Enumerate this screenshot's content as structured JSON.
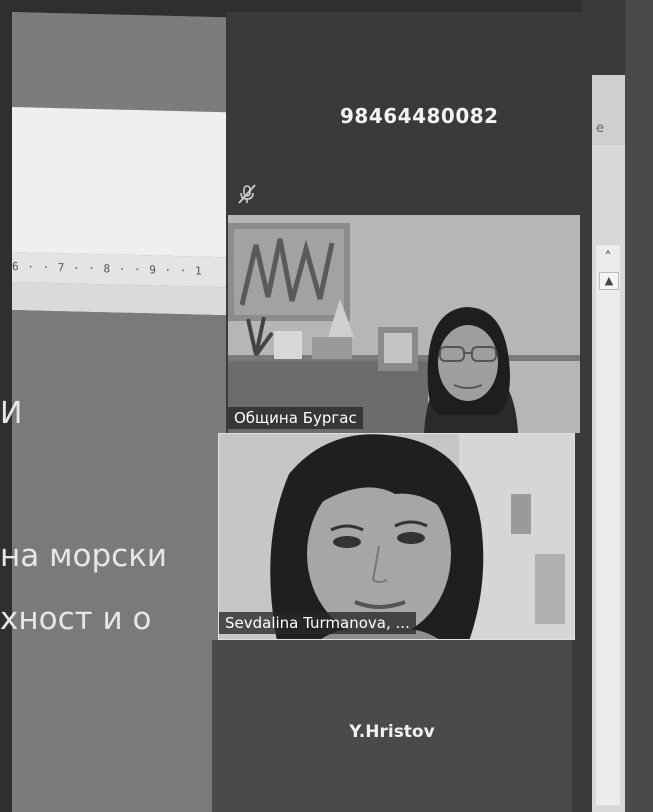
{
  "slide": {
    "ruler": "6 · · 7 · · 8 · · 9 · · 1",
    "text_line_1": "И",
    "text_line_2": "на морски",
    "text_line_3": "хност и о"
  },
  "meeting": {
    "meeting_id": "98464480082",
    "participants": [
      {
        "name": "Община Бургас",
        "video": true
      },
      {
        "name": "Sevdalina Turmanova, ...",
        "video": true
      },
      {
        "name": "Y.Hristov",
        "video": false
      }
    ]
  },
  "background_window": {
    "title_fragment": "e"
  },
  "icons": {
    "muted": "muted-microphone-icon",
    "scroll_up": "chevron-up-icon",
    "scroll_up_small": "triangle-up-icon"
  }
}
